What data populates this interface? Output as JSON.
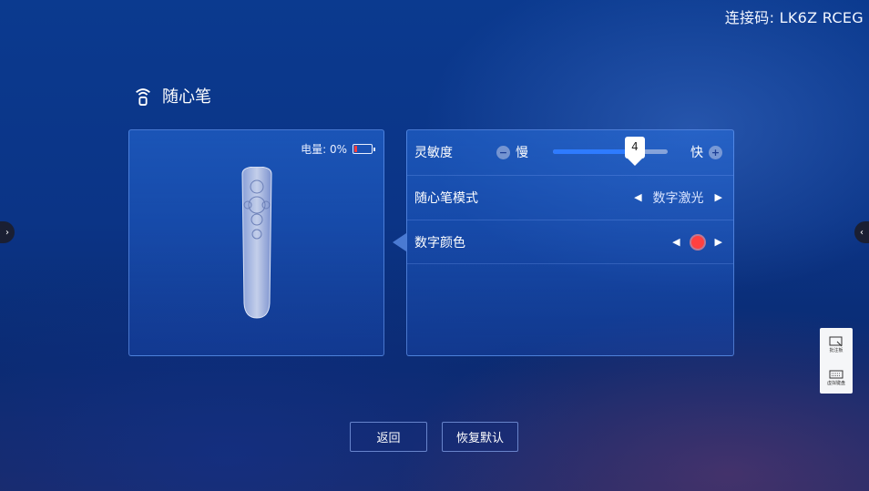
{
  "connection": {
    "label": "连接码: LK6Z RCEG"
  },
  "page": {
    "title": "随心笔"
  },
  "device": {
    "battery_label": "电量: 0%",
    "battery_level": 0
  },
  "settings": {
    "sensitivity": {
      "label": "灵敏度",
      "slow_label": "慢",
      "fast_label": "快",
      "value": 4,
      "min": 1,
      "max": 5
    },
    "mode": {
      "label": "随心笔模式",
      "value": "数字激光"
    },
    "color": {
      "label": "数字颜色",
      "value_color": "#ff4040"
    }
  },
  "actions": {
    "back_label": "返回",
    "reset_label": "恢复默认"
  },
  "dock": {
    "item1_label": "批注板",
    "item2_label": "虚拟键盘"
  },
  "icons": {
    "title_icon": "wireless-pen-icon",
    "left_arrow": "chevron-right-icon",
    "right_arrow": "chevron-left-icon"
  }
}
